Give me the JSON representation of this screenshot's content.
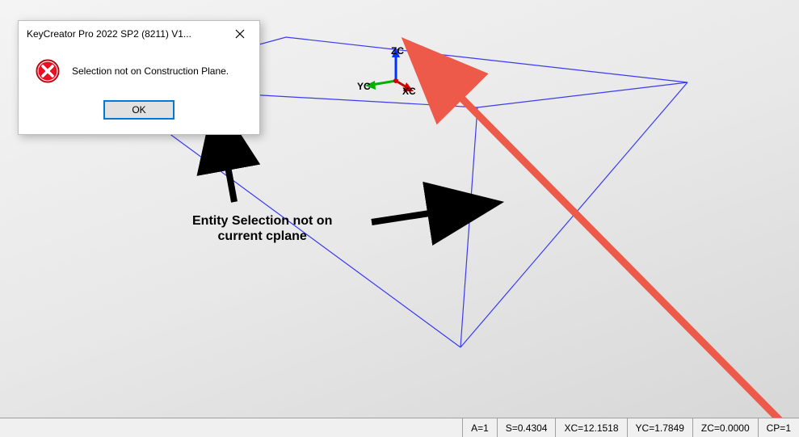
{
  "dialog": {
    "title": "KeyCreator Pro 2022 SP2 (8211) V1...",
    "message": "Selection not on Construction Plane.",
    "ok_label": "OK"
  },
  "gizmo": {
    "z_label": "ZC",
    "y_label": "YC",
    "x_label": "XC"
  },
  "annotation": {
    "line1": "Entity Selection not on",
    "line2": "current cplane"
  },
  "statusbar": {
    "a": "A=1",
    "s": "S=0.4304",
    "xc": "XC=12.1518",
    "yc": "YC=1.7849",
    "zc": "ZC=0.0000",
    "cp": "CP=1"
  },
  "colors": {
    "wire": "#3a3af0",
    "arrow_black": "#000000",
    "arrow_red": "#ee5a4a",
    "accent": "#0078d7"
  }
}
